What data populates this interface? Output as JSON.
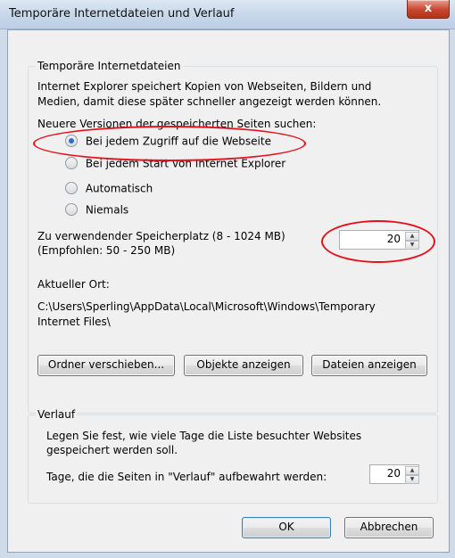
{
  "window": {
    "title": "Temporäre Internetdateien und Verlauf",
    "close_label": "x"
  },
  "temp_files": {
    "group_title": "Temporäre Internetdateien",
    "description_line1": "Internet Explorer speichert Kopien von Webseiten, Bildern und",
    "description_line2": "Medien, damit diese später schneller angezeigt werden können.",
    "check_label": "Neuere Versionen der gespeicherten Seiten suchen:",
    "options": [
      {
        "label": "Bei jedem Zugriff auf die Webseite",
        "checked": true
      },
      {
        "label": "Bei jedem Start von Internet Explorer",
        "checked": false
      },
      {
        "label": "Automatisch",
        "checked": false
      },
      {
        "label": "Niemals",
        "checked": false
      }
    ],
    "space_label_line1": "Zu verwendender Speicherplatz (8 - 1024 MB)",
    "space_label_line2": "(Empfohlen: 50 - 250 MB)",
    "space_value": "20",
    "location_label": "Aktueller Ort:",
    "location_line1": "C:\\Users\\Sperling\\AppData\\Local\\Microsoft\\Windows\\Temporary",
    "location_line2": "Internet Files\\",
    "buttons": {
      "move_folder": "Ordner verschieben...",
      "view_objects": "Objekte anzeigen",
      "view_files": "Dateien anzeigen"
    }
  },
  "history": {
    "group_title": "Verlauf",
    "description_line1": "Legen Sie fest, wie viele Tage die Liste besuchter Websites",
    "description_line2": "gespeichert werden soll.",
    "days_label": "Tage, die die Seiten in \"Verlauf\" aufbewahrt werden:",
    "days_value": "20"
  },
  "dialog_buttons": {
    "ok": "OK",
    "cancel": "Abbrechen"
  },
  "colors": {
    "annotation": "#e3111c",
    "radio_accent": "#2a6fc9"
  }
}
